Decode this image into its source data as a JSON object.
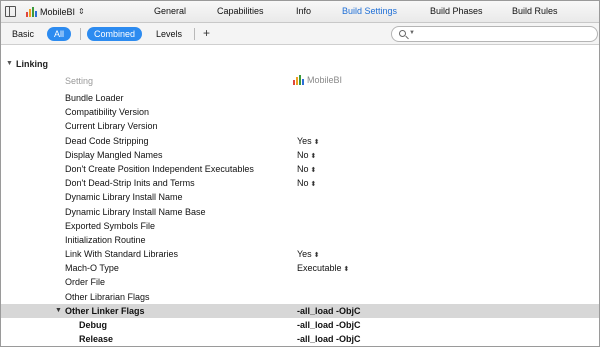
{
  "target": {
    "name": "MobileBI"
  },
  "tabs": [
    {
      "label": "General",
      "active": false
    },
    {
      "label": "Capabilities",
      "active": false
    },
    {
      "label": "Info",
      "active": false
    },
    {
      "label": "Build Settings",
      "active": true
    },
    {
      "label": "Build Phases",
      "active": false
    },
    {
      "label": "Build Rules",
      "active": false
    }
  ],
  "filter": {
    "basic": "Basic",
    "all": "All",
    "combined": "Combined",
    "levels": "Levels",
    "add": "+",
    "search_value": ""
  },
  "section": {
    "title": "Linking"
  },
  "columns": {
    "setting": "Setting",
    "target": "MobileBI"
  },
  "rows": [
    {
      "name": "Bundle Loader",
      "value": ""
    },
    {
      "name": "Compatibility Version",
      "value": ""
    },
    {
      "name": "Current Library Version",
      "value": ""
    },
    {
      "name": "Dead Code Stripping",
      "value": "Yes"
    },
    {
      "name": "Display Mangled Names",
      "value": "No"
    },
    {
      "name": "Don't Create Position Independent Executables",
      "value": "No"
    },
    {
      "name": "Don't Dead-Strip Inits and Terms",
      "value": "No"
    },
    {
      "name": "Dynamic Library Install Name",
      "value": ""
    },
    {
      "name": "Dynamic Library Install Name Base",
      "value": ""
    },
    {
      "name": "Exported Symbols File",
      "value": ""
    },
    {
      "name": "Initialization Routine",
      "value": ""
    },
    {
      "name": "Link With Standard Libraries",
      "value": "Yes"
    },
    {
      "name": "Mach-O Type",
      "value": "Executable"
    },
    {
      "name": "Order File",
      "value": ""
    },
    {
      "name": "Other Librarian Flags",
      "value": ""
    },
    {
      "name": "Other Linker Flags",
      "value": "-all_load -ObjC"
    },
    {
      "name": "Debug",
      "value": "-all_load -ObjC"
    },
    {
      "name": "Release",
      "value": "-all_load -ObjC"
    }
  ],
  "colors": {
    "accent": "#2c8bf0",
    "active_tab": "#1f6fd6",
    "group_row": "#d7d7d7"
  }
}
